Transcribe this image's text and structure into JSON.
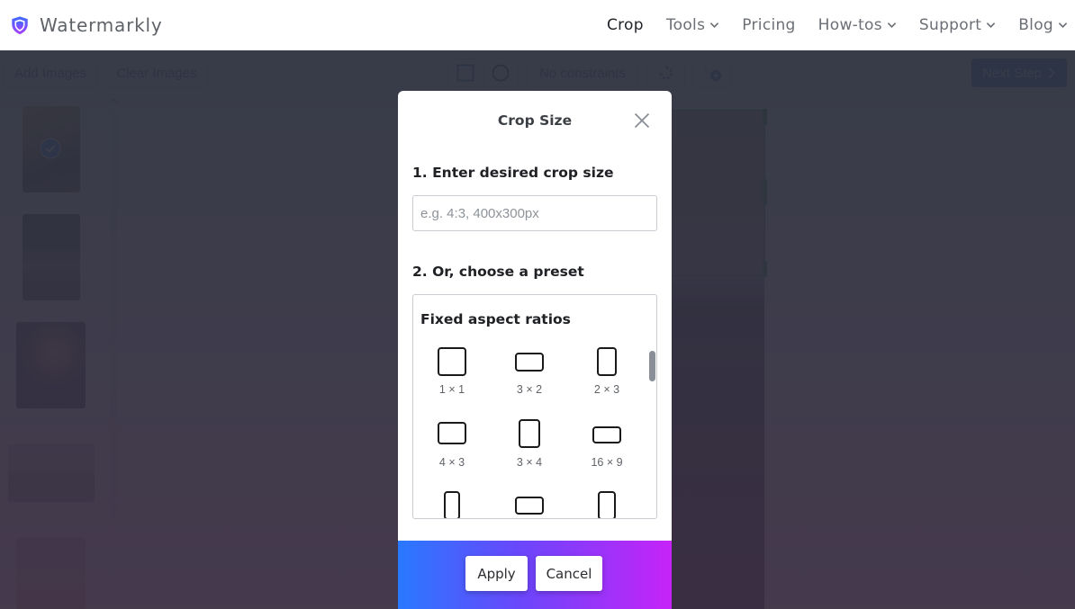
{
  "header": {
    "brand": "Watermarkly",
    "nav": [
      {
        "label": "Crop",
        "active": true,
        "dropdown": false
      },
      {
        "label": "Tools",
        "active": false,
        "dropdown": true
      },
      {
        "label": "Pricing",
        "active": false,
        "dropdown": false
      },
      {
        "label": "How-tos",
        "active": false,
        "dropdown": true
      },
      {
        "label": "Support",
        "active": false,
        "dropdown": true
      },
      {
        "label": "Blog",
        "active": false,
        "dropdown": true
      }
    ]
  },
  "toolbar": {
    "add_images": "Add Images",
    "clear_images": "Clear Images",
    "shape_rect_icon": "square-icon",
    "shape_circle_icon": "circle-icon",
    "constraints": "No constraints",
    "rotate_icon": "rotate-icon",
    "add_ratio_icon": "add-ratio-icon",
    "next_step": "Next Step"
  },
  "sidebar": {
    "thumbnails": [
      {
        "name": "woman-with-laptop",
        "selected": true
      },
      {
        "name": "person-in-forest",
        "selected": false
      },
      {
        "name": "woman-with-headphones",
        "selected": false
      },
      {
        "name": "woman-at-monument",
        "selected": false
      },
      {
        "name": "hot-air-balloons",
        "selected": false
      }
    ]
  },
  "modal": {
    "title": "Crop Size",
    "step1": "1. Enter desired crop size",
    "input_placeholder": "e.g. 4:3, 400x300px",
    "input_value": "",
    "step2": "2. Or, choose a preset",
    "preset_heading": "Fixed aspect ratios",
    "presets": [
      {
        "label": "1 × 1"
      },
      {
        "label": "3 × 2"
      },
      {
        "label": "2 × 3"
      },
      {
        "label": "4 × 3"
      },
      {
        "label": "3 × 4"
      },
      {
        "label": "16 × 9"
      },
      {
        "label": ""
      },
      {
        "label": ""
      },
      {
        "label": ""
      }
    ],
    "apply": "Apply",
    "cancel": "Cancel"
  },
  "colors": {
    "brand_gradient_start": "#2979ff",
    "brand_gradient_mid": "#6b46fb",
    "brand_gradient_end": "#c623f7",
    "primary": "#0d5bd7",
    "crop_handle": "#0d7a22"
  }
}
